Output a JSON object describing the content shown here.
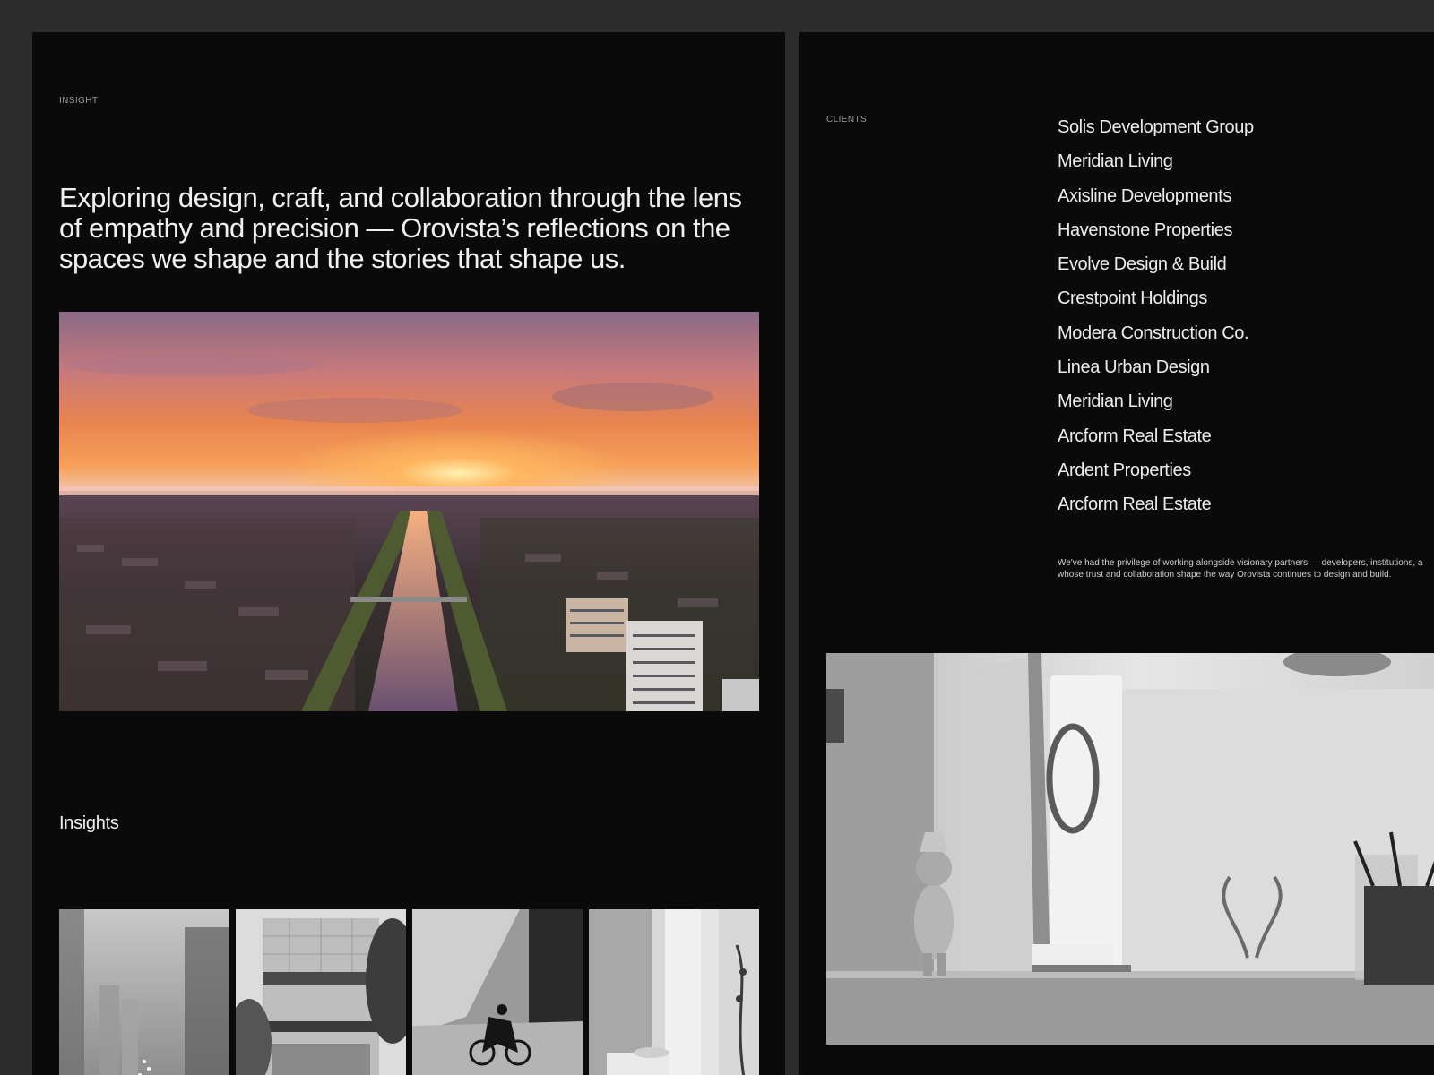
{
  "insight": {
    "eyebrow": "INSIGHT",
    "headline": "Exploring design, craft, and collaboration through the lens of empathy and precision — Orovista’s reflections on the spaces we shape and the stories that shape us.",
    "section_title": "Insights"
  },
  "clients": {
    "eyebrow": "CLIENTS",
    "items": [
      "Solis Development Group",
      "Meridian Living",
      "Axisline Developments",
      "Havenstone Properties",
      "Evolve Design & Build",
      "Crestpoint Holdings",
      "Modera Construction Co.",
      "Linea Urban Design",
      "Meridian Living",
      "Arcform Real Estate",
      "Ardent Properties",
      "Arcform Real Estate"
    ],
    "note_line1": "We've had the privilege of working alongside visionary partners — developers, institutions, a",
    "note_line2": "whose trust and collaboration shape the way Orovista continues to design and build."
  },
  "colors": {
    "page_background": "#2c2c2c",
    "panel_background": "#0a0a0a",
    "text_primary": "#f0f0f0",
    "text_muted": "#9a9a9a"
  }
}
